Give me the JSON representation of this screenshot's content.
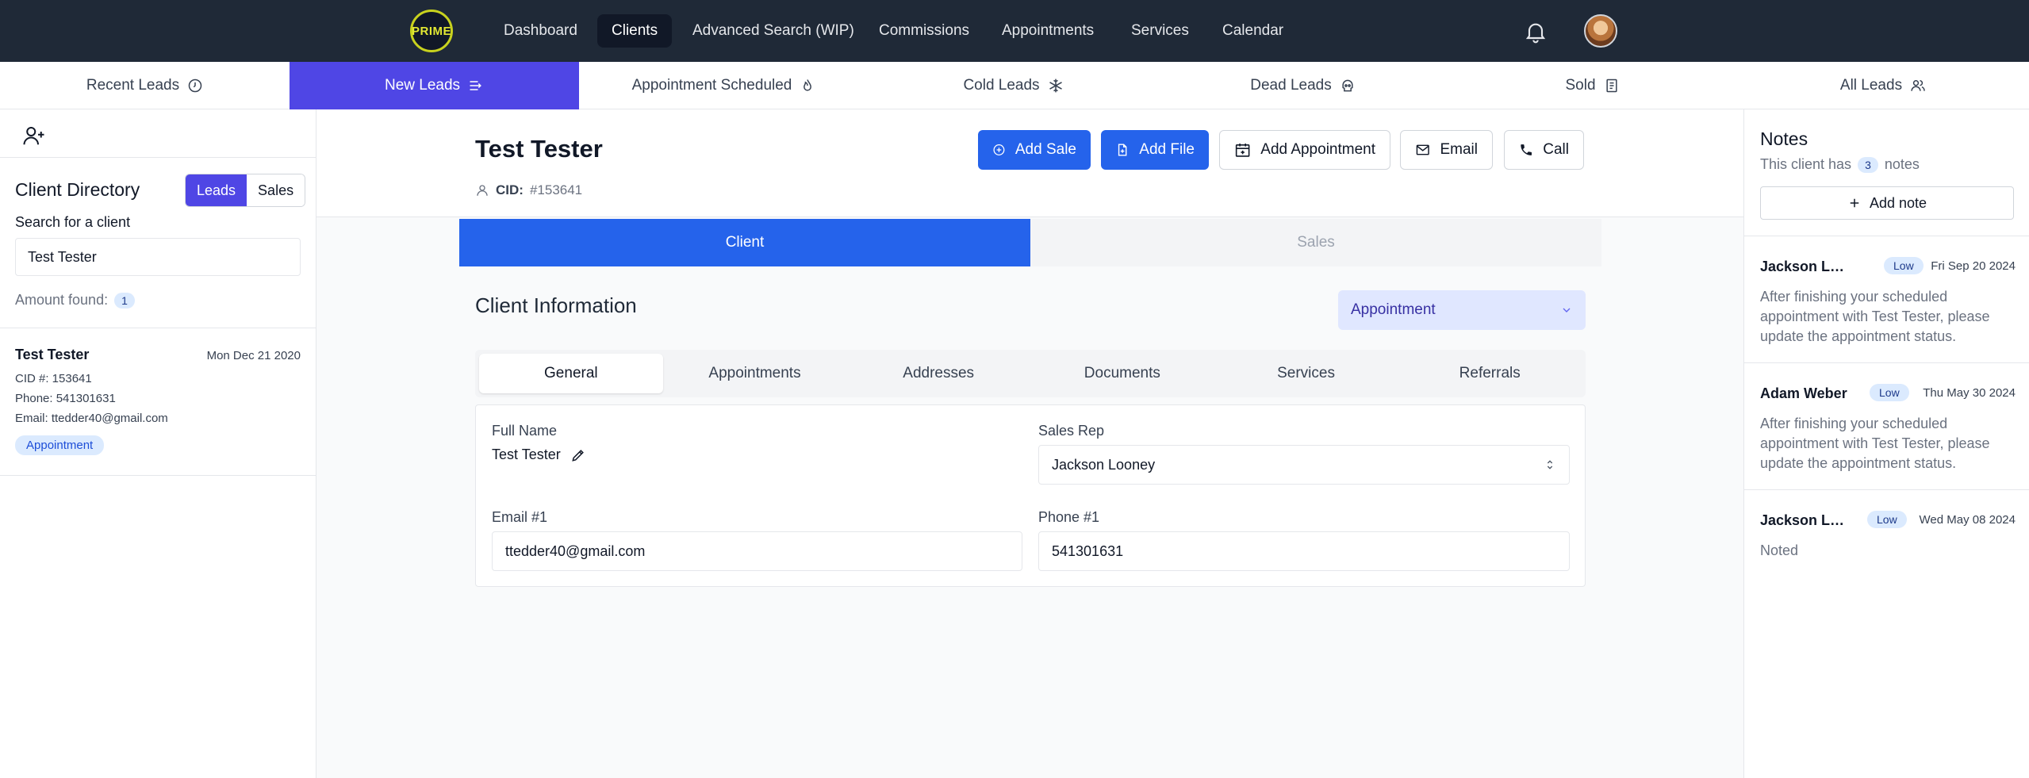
{
  "app": {
    "logo_text": "PRIME"
  },
  "nav": {
    "items": [
      {
        "label": "Dashboard"
      },
      {
        "label": "Clients",
        "active": true
      },
      {
        "label": "Advanced Search (WIP)"
      },
      {
        "label": "Commissions"
      },
      {
        "label": "Appointments"
      },
      {
        "label": "Services"
      },
      {
        "label": "Calendar"
      }
    ]
  },
  "lead_tabs": [
    {
      "label": "Recent Leads",
      "icon": "clock-icon"
    },
    {
      "label": "New Leads",
      "icon": "lines-arrow-icon",
      "active": true
    },
    {
      "label": "Appointment Scheduled",
      "icon": "flame-icon"
    },
    {
      "label": "Cold Leads",
      "icon": "snowflake-icon"
    },
    {
      "label": "Dead Leads",
      "icon": "skull-icon"
    },
    {
      "label": "Sold",
      "icon": "receipt-icon"
    },
    {
      "label": "All Leads",
      "icon": "users-icon"
    }
  ],
  "sidebar": {
    "title": "Client Directory",
    "toggle": {
      "leads": "Leads",
      "sales": "Sales"
    },
    "search_label": "Search for a client",
    "search_value": "Test Tester",
    "amount_label": "Amount found:",
    "amount_count": "1",
    "results": [
      {
        "name": "Test Tester",
        "date": "Mon Dec 21 2020",
        "cid": "CID #: 153641",
        "phone": "Phone: 541301631",
        "email": "Email: ttedder40@gmail.com",
        "status": "Appointment"
      }
    ]
  },
  "client": {
    "name": "Test Tester",
    "cid_label": "CID:",
    "cid_value": "#153641"
  },
  "actions": {
    "add_sale": "Add Sale",
    "add_file": "Add File",
    "add_appointment": "Add Appointment",
    "email": "Email",
    "call": "Call"
  },
  "view_tabs": {
    "client": "Client",
    "sales": "Sales"
  },
  "client_info": {
    "title": "Client Information",
    "stage": "Appointment",
    "tabs": [
      "General",
      "Appointments",
      "Addresses",
      "Documents",
      "Services",
      "Referrals"
    ],
    "fields": {
      "full_name_label": "Full Name",
      "full_name": "Test Tester",
      "sales_rep_label": "Sales Rep",
      "sales_rep": "Jackson Looney",
      "email_label": "Email #1",
      "email": "ttedder40@gmail.com",
      "phone_label": "Phone #1",
      "phone": "541301631"
    }
  },
  "notes": {
    "title": "Notes",
    "sub_prefix": "This client has",
    "count": "3",
    "sub_suffix": "notes",
    "add_label": "Add note",
    "items": [
      {
        "author": "Jackson Looney",
        "priority": "Low",
        "date": "Fri Sep 20 2024",
        "body": "After finishing your scheduled appointment with Test Tester, please update the appointment status."
      },
      {
        "author": "Adam Weber",
        "priority": "Low",
        "date": "Thu May 30 2024",
        "body": "After finishing your scheduled appointment with Test Tester, please update the appointment status."
      },
      {
        "author": "Jackson Looney",
        "priority": "Low",
        "date": "Wed May 08 2024",
        "body": "Noted"
      }
    ]
  },
  "colors": {
    "topbar": "#1f2937",
    "indigo": "#4f46e5",
    "primary_blue": "#2563eb",
    "badge_bg": "#dbeafe"
  }
}
